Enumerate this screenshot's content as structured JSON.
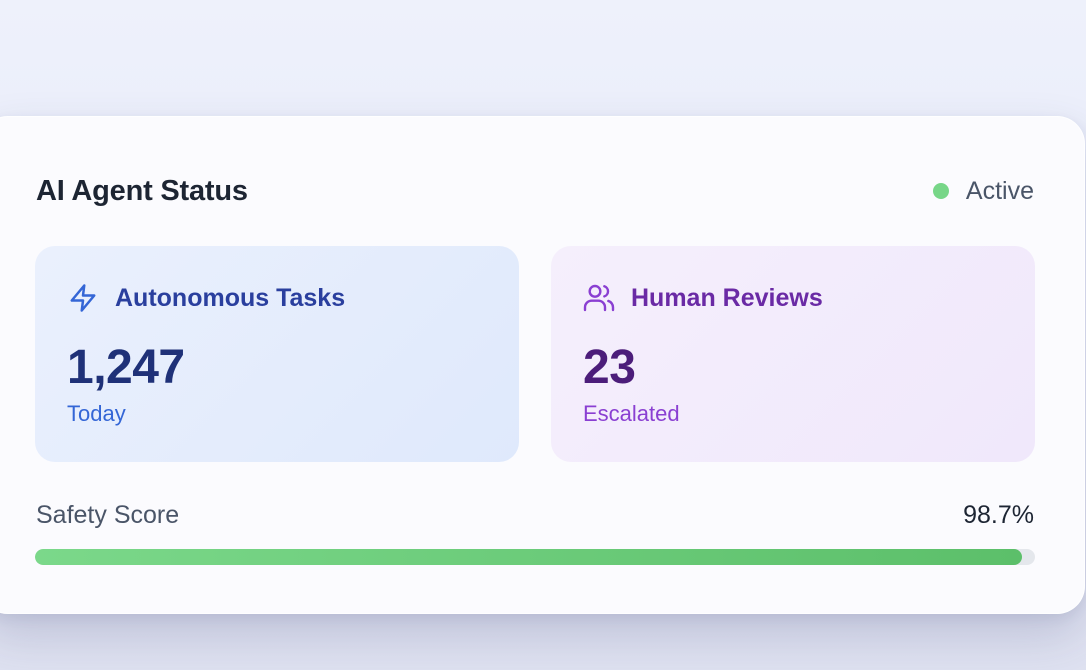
{
  "card": {
    "title": "AI Agent Status",
    "status": {
      "label": "Active",
      "color": "#77d688"
    }
  },
  "tiles": [
    {
      "icon": "lightning-bolt-icon",
      "label": "Autonomous Tasks",
      "value": "1,247",
      "sub": "Today",
      "accent": "#3466d6"
    },
    {
      "icon": "users-icon",
      "label": "Human Reviews",
      "value": "23",
      "sub": "Escalated",
      "accent": "#8a3fd2"
    }
  ],
  "metric": {
    "label": "Safety Score",
    "value_text": "98.7%",
    "progress_percent": 98.7,
    "bar_color": "#6fcf7e"
  }
}
